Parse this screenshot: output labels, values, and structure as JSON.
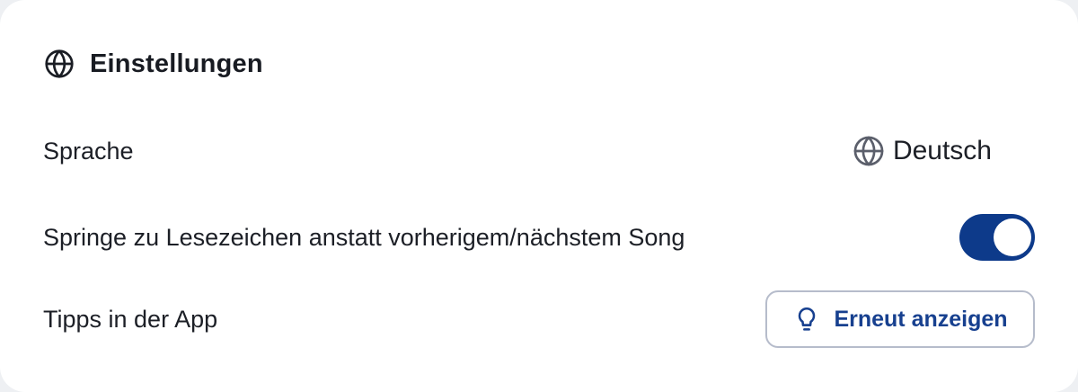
{
  "settings": {
    "title": "Einstellungen",
    "title_icon": "globe-icon",
    "language": {
      "label": "Sprache",
      "value": "Deutsch",
      "icon": "globe-icon"
    },
    "jump_to_bookmarks": {
      "label": "Springe zu Lesezeichen anstatt vorherigem/nächstem Song",
      "enabled": true
    },
    "tips": {
      "label": "Tipps in der App",
      "button_label": "Erneut anzeigen",
      "button_icon": "lightbulb-icon"
    }
  },
  "colors": {
    "accent": "#0d3a8a",
    "button_text": "#17408f",
    "button_border": "#b6bccb",
    "background": "#eef0f3",
    "card": "#ffffff"
  }
}
